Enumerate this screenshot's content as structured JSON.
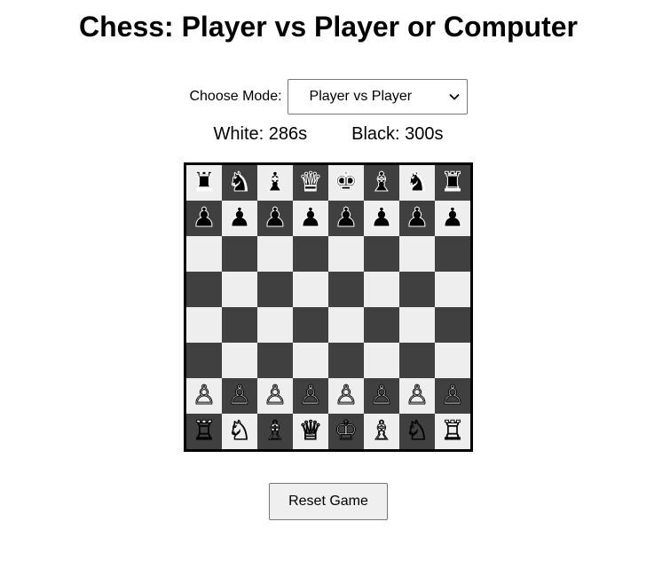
{
  "title": "Chess: Player vs Player or Computer",
  "mode": {
    "label": "Choose Mode:",
    "selected": "Player vs Player",
    "icon": "chevron-down-icon"
  },
  "timers": {
    "white": "White: 286s",
    "black": "Black: 300s"
  },
  "board": {
    "light_color": "#eeeeee",
    "dark_color": "#404040",
    "ranks": [
      [
        [
          "♜",
          "b",
          "rook"
        ],
        [
          "♞",
          "b",
          "knight"
        ],
        [
          "♝",
          "b",
          "bishop"
        ],
        [
          "♛",
          "b",
          "queen"
        ],
        [
          "♚",
          "b",
          "king"
        ],
        [
          "♝",
          "b",
          "bishop"
        ],
        [
          "♞",
          "b",
          "knight"
        ],
        [
          "♜",
          "b",
          "rook"
        ]
      ],
      [
        [
          "♟",
          "b",
          "pawn"
        ],
        [
          "♟",
          "b",
          "pawn"
        ],
        [
          "♟",
          "b",
          "pawn"
        ],
        [
          "♟",
          "b",
          "pawn"
        ],
        [
          "♟",
          "b",
          "pawn"
        ],
        [
          "♟",
          "b",
          "pawn"
        ],
        [
          "♟",
          "b",
          "pawn"
        ],
        [
          "♟",
          "b",
          "pawn"
        ]
      ],
      [
        null,
        null,
        null,
        null,
        null,
        null,
        null,
        null
      ],
      [
        null,
        null,
        null,
        null,
        null,
        null,
        null,
        null
      ],
      [
        null,
        null,
        null,
        null,
        null,
        null,
        null,
        null
      ],
      [
        null,
        null,
        null,
        null,
        null,
        null,
        null,
        null
      ],
      [
        [
          "♙",
          "w",
          "pawn"
        ],
        [
          "♙",
          "w",
          "pawn"
        ],
        [
          "♙",
          "w",
          "pawn"
        ],
        [
          "♙",
          "w",
          "pawn"
        ],
        [
          "♙",
          "w",
          "pawn"
        ],
        [
          "♙",
          "w",
          "pawn"
        ],
        [
          "♙",
          "w",
          "pawn"
        ],
        [
          "♙",
          "w",
          "pawn"
        ]
      ],
      [
        [
          "♖",
          "w",
          "rook"
        ],
        [
          "♘",
          "w",
          "knight"
        ],
        [
          "♗",
          "w",
          "bishop"
        ],
        [
          "♕",
          "w",
          "queen"
        ],
        [
          "♔",
          "w",
          "king"
        ],
        [
          "♗",
          "w",
          "bishop"
        ],
        [
          "♘",
          "w",
          "knight"
        ],
        [
          "♖",
          "w",
          "rook"
        ]
      ]
    ]
  },
  "reset_label": "Reset Game"
}
